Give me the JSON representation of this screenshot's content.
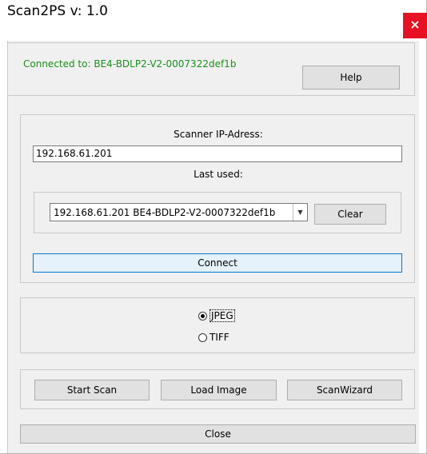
{
  "window": {
    "title": "Scan2PS v: 1.0",
    "close_glyph": "×"
  },
  "connection": {
    "status": "Connected to: BE4-BDLP2-V2-0007322def1b",
    "help_label": "Help"
  },
  "scanner": {
    "ip_label": "Scanner IP-Adress:",
    "ip_value": "192.168.61.201",
    "last_used_label": "Last used:",
    "last_used_selected": "192.168.61.201 BE4-BDLP2-V2-0007322def1b",
    "clear_label": "Clear",
    "connect_label": "Connect"
  },
  "format": {
    "jpeg_label": "JPEG",
    "tiff_label": "TIFF",
    "selected": "JPEG"
  },
  "actions": {
    "start_scan_label": "Start Scan",
    "load_image_label": "Load Image",
    "scan_wizard_label": "ScanWizard",
    "close_label": "Close"
  },
  "colors": {
    "status_text": "#1a8f1a",
    "close_button_bg": "#e81123",
    "focus_border": "#0078d7"
  },
  "icons": {
    "dropdown": "chevron-down-icon",
    "close": "close-icon"
  }
}
